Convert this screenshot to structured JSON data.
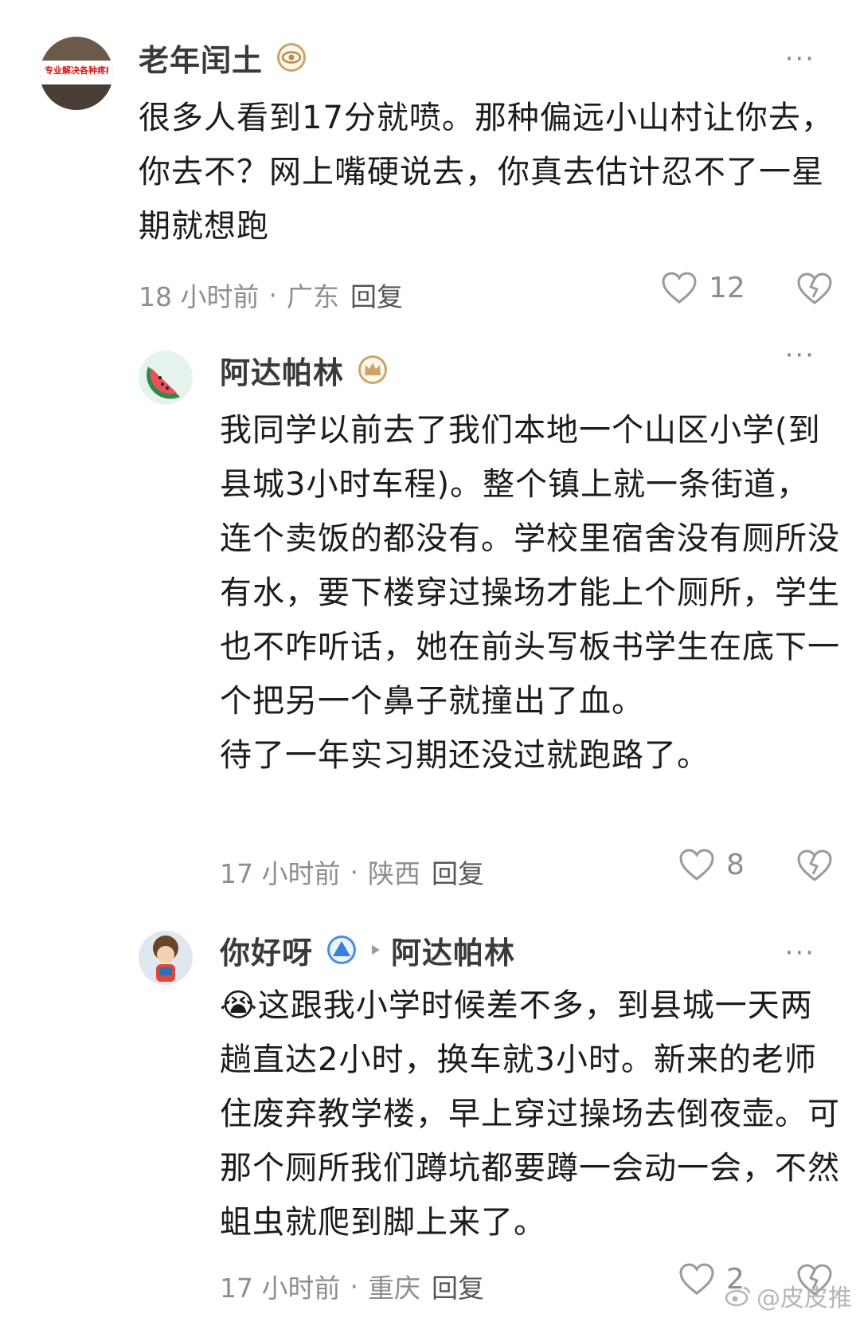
{
  "comments": [
    {
      "author": "老年闰土",
      "text": "很多人看到17分就喷。那种偏远小山村让你去，你去不？网上嘴硬说去，你真去估计忍不了一星期就想跑",
      "time": "18 小时前",
      "region": "广东",
      "reply_label": "回复",
      "likes": "12",
      "avatar_sign_text": "专业解决各种疼痛",
      "badge_icon": "eye-badge-icon"
    },
    {
      "author": "阿达帕林",
      "text": "我同学以前去了我们本地一个山区小学(到县城3小时车程)。整个镇上就一条街道，连个卖饭的都没有。学校里宿舍没有厕所没有水，要下楼穿过操场才能上个厕所，学生也不咋听话，她在前头写板书学生在底下一个把另一个鼻子就撞出了血。\n待了一年实习期还没过就跑路了。",
      "time": "17 小时前",
      "region": "陕西",
      "reply_label": "回复",
      "likes": "8",
      "badge_icon": "crown-badge-icon"
    },
    {
      "author": "你好呀",
      "reply_to": "阿达帕林",
      "text": "这跟我小学时候差不多，到县城一天两趟直达2小时，换车就3小时。新来的老师住废弃教学楼，早上穿过操场去倒夜壶。可那个厕所我们蹲坑都要蹲一会动一会，不然蛆虫就爬到脚上来了。",
      "emoji": "😭",
      "time": "17 小时前",
      "region": "重庆",
      "reply_label": "回复",
      "likes": "2",
      "badge_icon": "triangle-badge-icon"
    }
  ],
  "more_label": "···",
  "separator": "·",
  "watermark": "@皮皮推",
  "colors": {
    "meta": "#8e8e8e",
    "name": "#3a3a3a",
    "badge_gold": "#c9a56b"
  }
}
